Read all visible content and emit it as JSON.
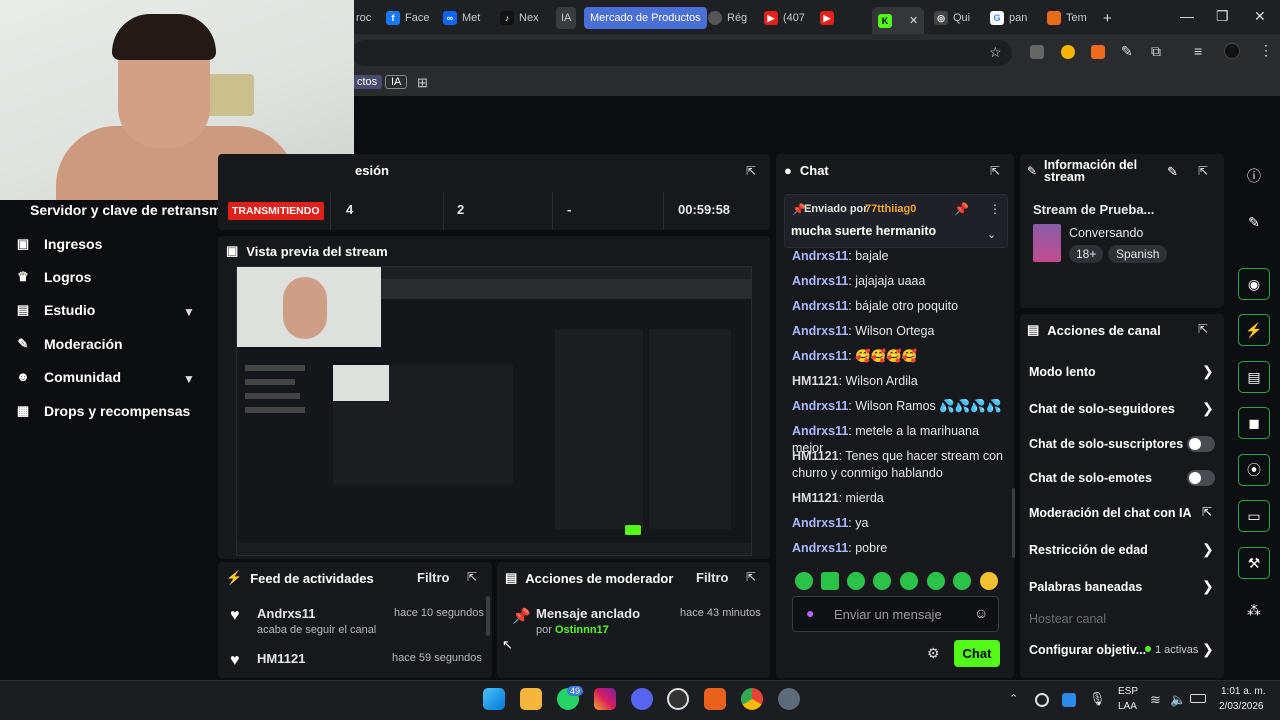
{
  "browser": {
    "tabs": [
      "roc",
      "Face",
      "Met",
      "Nex",
      "IA",
      "Mercado de Productos",
      "Rég",
      "(407",
      "",
      "",
      "Qui",
      "pan",
      "Tem"
    ],
    "bookmarks": [
      "ctos",
      "IA"
    ]
  },
  "stats": {
    "title_suffix": "esión",
    "retransmit_label": "Servidor y clave de retransm",
    "live_badge": "TRANSMITIENDO",
    "values": [
      "4",
      "2",
      "-",
      "00:59:58"
    ]
  },
  "sidebar": {
    "items": [
      {
        "label": "Ingresos",
        "icon": "money-icon"
      },
      {
        "label": "Logros",
        "icon": "trophy-icon"
      },
      {
        "label": "Estudio",
        "icon": "film-icon"
      },
      {
        "label": "Moderación",
        "icon": "wrench-icon"
      },
      {
        "label": "Comunidad",
        "icon": "people-icon"
      },
      {
        "label": "Drops y recompensas",
        "icon": "gift-icon"
      }
    ]
  },
  "preview": {
    "title": "Vista previa del stream"
  },
  "activity": {
    "title": "Feed de actividades",
    "filter": "Filtro",
    "items": [
      {
        "user": "Andrxs11",
        "time": "hace 10 segundos",
        "detail": "acaba de seguir el canal"
      },
      {
        "user": "HM1121",
        "time": "hace 59 segundos",
        "detail": ""
      }
    ]
  },
  "modactions": {
    "title": "Acciones de moderador",
    "filter": "Filtro",
    "item": {
      "title": "Mensaje anclado",
      "time": "hace 43 minutos",
      "by_label": "por",
      "by_user": "Ostinnn17"
    }
  },
  "chat": {
    "title": "Chat",
    "pinned": {
      "label": "Enviado por",
      "user": "77tthiiag0",
      "message": "mucha suerte hermanito"
    },
    "messages": [
      {
        "user": "Andrxs11",
        "text": ": bajale"
      },
      {
        "user": "Andrxs11",
        "text": ": jajajaja uaaa"
      },
      {
        "user": "Andrxs11",
        "text": ": bájale otro poquito"
      },
      {
        "user": "Andrxs11",
        "text": ": Wilson Ortega"
      },
      {
        "user": "Andrxs11",
        "text": ": 🥰🥰🥰🥰"
      },
      {
        "user": "HM1121",
        "text": ": Wilson Ardila"
      },
      {
        "user": "Andrxs11",
        "text": ": Wilson Ramos 💦💦💦💦"
      },
      {
        "user": "Andrxs11",
        "text": ": metele a la marihuana mejor"
      },
      {
        "user": "HM1121",
        "text": ": Tenes que hacer stream con churro y conmigo hablando"
      },
      {
        "user": "HM1121",
        "text": ": mierda"
      },
      {
        "user": "Andrxs11",
        "text": ": ya"
      },
      {
        "user": "Andrxs11",
        "text": ": pobre"
      }
    ],
    "input_placeholder": "Enviar un mensaje",
    "send": "Chat"
  },
  "streaminfo": {
    "title": "Información del stream",
    "stream_title": "Stream de Prueba...",
    "category": "Conversando",
    "tags": [
      "18+",
      "Spanish"
    ]
  },
  "channel": {
    "title": "Acciones de canal",
    "items": [
      {
        "label": "Modo lento",
        "control": "arrow"
      },
      {
        "label": "Chat de solo-seguidores",
        "control": "arrow"
      },
      {
        "label": "Chat de solo-suscriptores",
        "control": "toggle"
      },
      {
        "label": "Chat de solo-emotes",
        "control": "toggle"
      },
      {
        "label": "Moderación del chat con IA",
        "control": "external"
      },
      {
        "label": "Restricción de edad",
        "control": "arrow"
      },
      {
        "label": "Palabras baneadas",
        "control": "arrow"
      },
      {
        "label": "Hostear canal",
        "control": "none"
      },
      {
        "label": "Configurar objetiv...",
        "control": "arrow",
        "extra": "1 activas"
      }
    ]
  },
  "taskbar": {
    "lang": "ESP",
    "region": "LAA",
    "time": "1:01 a. m.",
    "date": "2/03/2026",
    "whatsapp_badge": "49"
  },
  "colors": {
    "accent": "#53fc18",
    "badge": "#e0201a",
    "panel": "#17181c"
  }
}
